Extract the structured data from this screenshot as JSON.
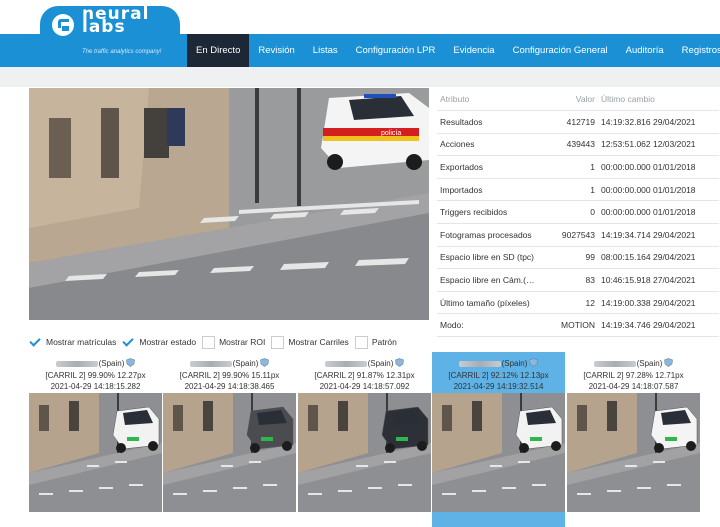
{
  "brand": {
    "line1": "neural",
    "line2": "labs",
    "tagline": "The traffic analytics company!",
    "color": "#1b90d4"
  },
  "nav": {
    "items": [
      {
        "label": "En Directo",
        "active": true
      },
      {
        "label": "Revisión",
        "active": false
      },
      {
        "label": "Listas",
        "active": false
      },
      {
        "label": "Configuración LPR",
        "active": false
      },
      {
        "label": "Evidencia",
        "active": false
      },
      {
        "label": "Configuración General",
        "active": false
      },
      {
        "label": "Auditoría",
        "active": false
      },
      {
        "label": "Registros",
        "active": false
      }
    ]
  },
  "camera": {
    "vehicle_text": "policía"
  },
  "stats": {
    "headers": {
      "attr": "Atributo",
      "value": "Valor",
      "change": "Último cambio"
    },
    "rows": [
      {
        "attr": "Resultados",
        "value": "412719",
        "change": "14:19:32.816 29/04/2021"
      },
      {
        "attr": "Acciones",
        "value": "439443",
        "change": "12:53:51.062 12/03/2021"
      },
      {
        "attr": "Exportados",
        "value": "1",
        "change": "00:00:00.000 01/01/2018"
      },
      {
        "attr": "Importados",
        "value": "1",
        "change": "00:00:00.000 01/01/2018"
      },
      {
        "attr": "Triggers recibidos",
        "value": "0",
        "change": "00:00:00.000 01/01/2018"
      },
      {
        "attr": "Fotogramas procesados",
        "value": "9027543",
        "change": "14:19:34.714 29/04/2021"
      },
      {
        "attr": "Espacio libre en SD (tpc)",
        "value": "99",
        "change": "08:00:15.164 29/04/2021"
      },
      {
        "attr": "Espacio libre en Cám.(t...",
        "value": "83",
        "change": "10:46:15.918 27/04/2021"
      },
      {
        "attr": "Último tamaño (píxeles)",
        "value": "12",
        "change": "14:19:00.338 29/04/2021"
      },
      {
        "attr": "Modo:",
        "value": "MOTION",
        "change": "14:19:34.746 29/04/2021"
      }
    ]
  },
  "options": [
    {
      "label": "Mostrar matrículas",
      "checked": true
    },
    {
      "label": "Mostrar estado",
      "checked": true
    },
    {
      "label": "Mostrar ROI",
      "checked": false
    },
    {
      "label": "Mostrar Carriles",
      "checked": false
    },
    {
      "label": "Patrón",
      "checked": false
    }
  ],
  "detections": [
    {
      "country": "(Spain)",
      "lane_line": "[CARRIL 2] 99.90% 12.27px",
      "timestamp": "2021-04-29 14:18:15.282",
      "car_color": "#f2f2f2",
      "selected": false
    },
    {
      "country": "(Spain)",
      "lane_line": "[CARRIL 2] 99.90% 15.11px",
      "timestamp": "2021-04-29 14:18:38.465",
      "car_color": "#4a4c50",
      "selected": false
    },
    {
      "country": "(Spain)",
      "lane_line": "[CARRIL 2] 91.87% 12.31px",
      "timestamp": "2021-04-29 14:18:57.092",
      "car_color": "#2d3036",
      "selected": false
    },
    {
      "country": "(Spain)",
      "lane_line": "[CARRIL 2] 92.12% 12.13px",
      "timestamp": "2021-04-29 14:19:32.514",
      "car_color": "#f2f2f2",
      "selected": true
    },
    {
      "country": "(Spain)",
      "lane_line": "[CARRIL 2] 97.28% 12.71px",
      "timestamp": "2021-04-29 14:18:07.587",
      "car_color": "#f4f4f4",
      "selected": false
    }
  ]
}
